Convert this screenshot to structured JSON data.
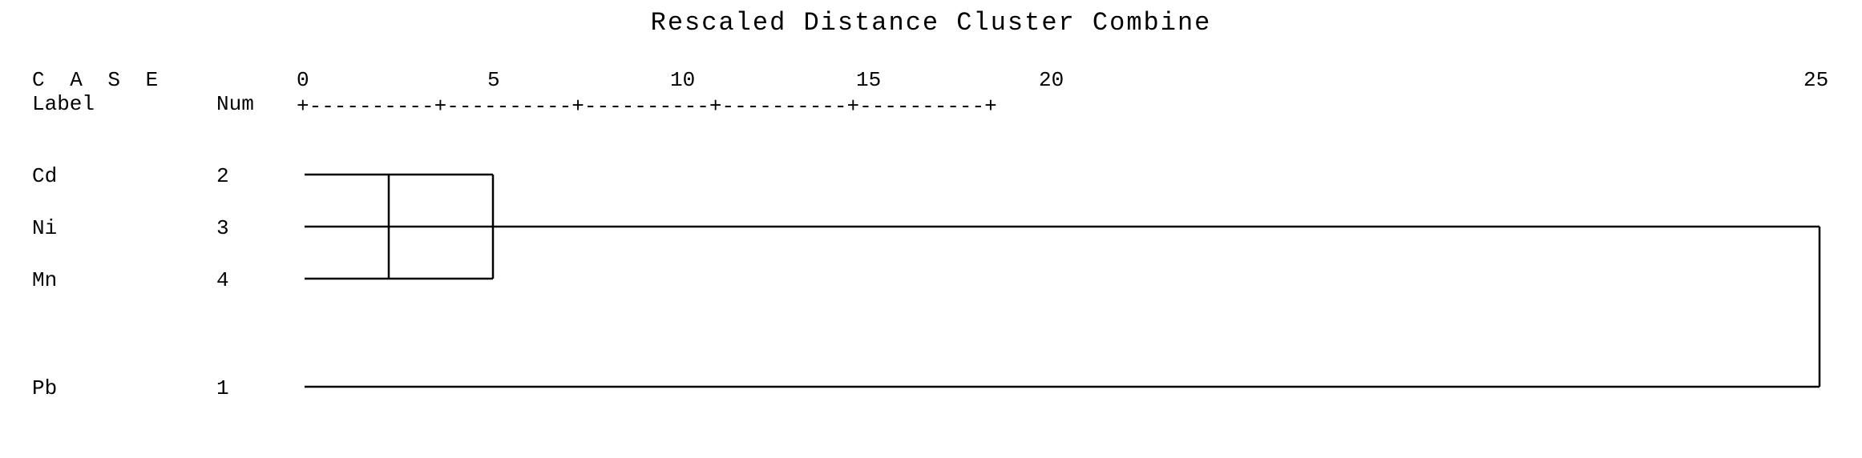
{
  "title": "Rescaled Distance Cluster Combine",
  "header": {
    "case_label": "C A S E",
    "label_col": "Label",
    "num_col": "Num"
  },
  "scale": {
    "values": [
      0,
      5,
      10,
      15,
      20,
      25
    ],
    "dash_line": "+----------+----------+----------+----------+----------+"
  },
  "rows": [
    {
      "label": "Cd",
      "num": "2"
    },
    {
      "label": "Ni",
      "num": "3"
    },
    {
      "label": "Mn",
      "num": "4"
    },
    {
      "label": "Pb",
      "num": "1"
    }
  ],
  "colors": {
    "background": "#ffffff",
    "text": "#000000",
    "lines": "#000000"
  }
}
